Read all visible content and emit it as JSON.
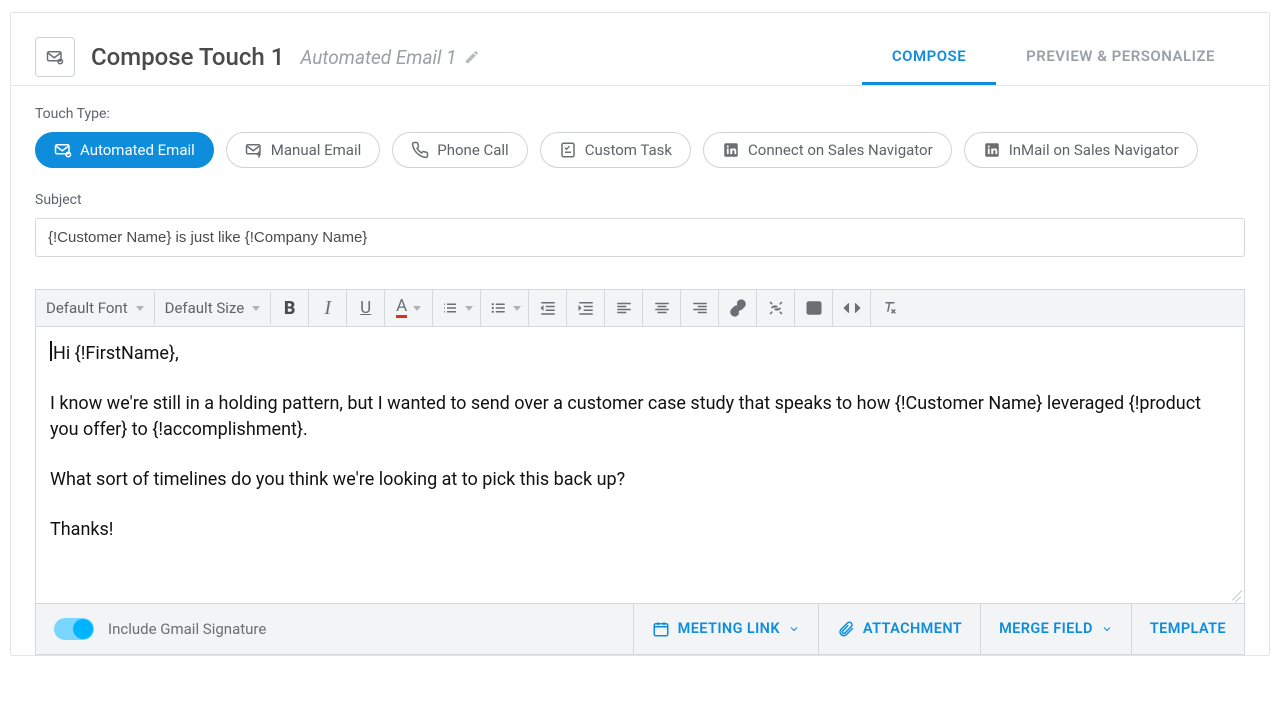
{
  "header": {
    "title": "Compose Touch 1",
    "subtitle": "Automated Email 1",
    "tabs": {
      "compose": "COMPOSE",
      "preview": "PREVIEW & PERSONALIZE"
    }
  },
  "touch_type": {
    "label": "Touch Type:",
    "options": {
      "auto_email": "Automated Email",
      "manual_email": "Manual Email",
      "phone_call": "Phone Call",
      "custom_task": "Custom Task",
      "connect_nav": "Connect on Sales Navigator",
      "inmail_nav": "InMail on Sales Navigator"
    }
  },
  "subject": {
    "label": "Subject",
    "value": "{!Customer Name} is just like {!Company Name}"
  },
  "toolbar": {
    "font_dd": "Default Font",
    "size_dd": "Default Size"
  },
  "body": {
    "l1": "Hi {!FirstName},",
    "l2": "I know we're still in a holding pattern, but I wanted to send over a customer case study that speaks to how {!Customer Name} leveraged {!product you offer} to {!accomplishment}.",
    "l3": "What sort of timelines do you think we're looking at to pick this back up?",
    "l4": "Thanks!"
  },
  "footer": {
    "gmail_signature": "Include Gmail Signature",
    "actions": {
      "meeting_link": "MEETING LINK",
      "attachment": "ATTACHMENT",
      "merge_field": "MERGE FIELD",
      "template": "TEMPLATE"
    }
  }
}
